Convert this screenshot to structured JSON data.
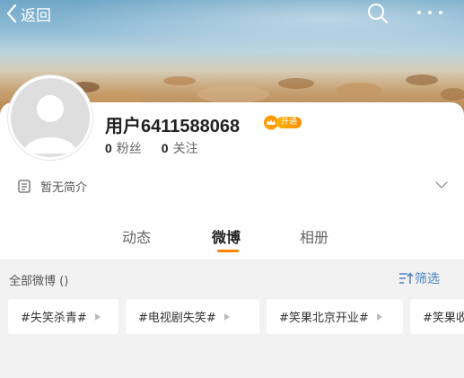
{
  "nav": {
    "back_label": "返回",
    "back_icon": "chevron-left-icon",
    "search_icon": "search-icon",
    "more_icon": "more-dots-icon"
  },
  "profile": {
    "username": "用户6411588068",
    "vip_label": "开通",
    "followers_count": "0",
    "followers_label": "粉丝",
    "following_count": "0",
    "following_label": "关注",
    "bio": "暂无简介"
  },
  "tabs": [
    {
      "label": "动态",
      "active": false
    },
    {
      "label": "微博",
      "active": true
    },
    {
      "label": "相册",
      "active": false
    }
  ],
  "filter": {
    "title": "全部微博 ()",
    "button_label": "筛选"
  },
  "hashtags": [
    "#失笑杀青#",
    "#电视剧失笑#",
    "#笑果北京开业#",
    "#笑果收"
  ],
  "colors": {
    "accent": "#ff8200",
    "link": "#4a7fc1",
    "vip": "#ff9a00"
  }
}
